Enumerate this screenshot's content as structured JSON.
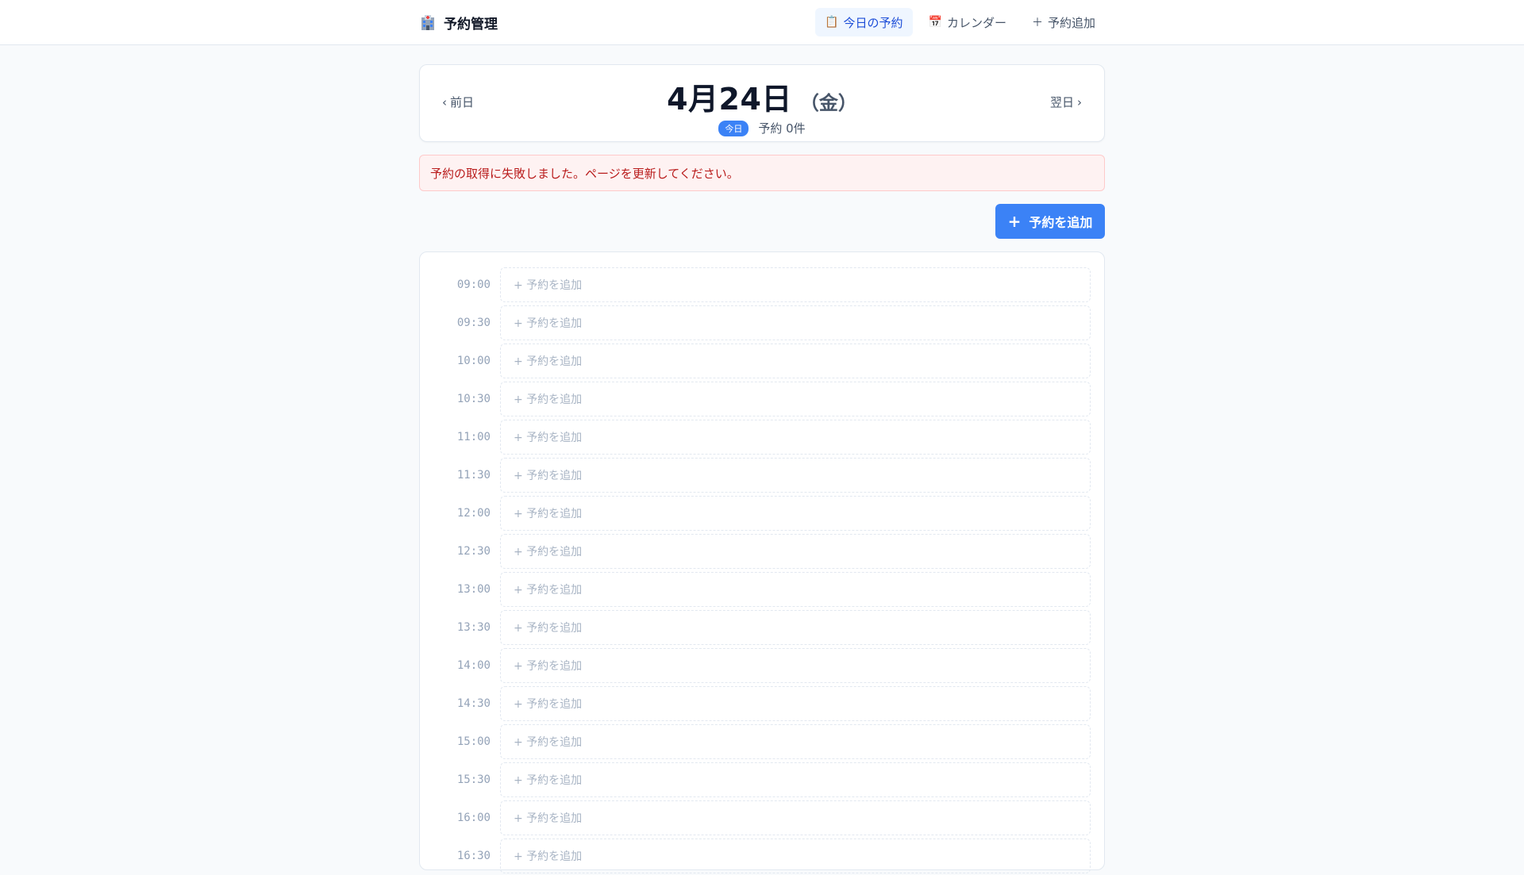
{
  "header": {
    "brand": "予約管理",
    "brand_icon": "hospital-icon",
    "nav": [
      {
        "icon": "📋",
        "icon_name": "clipboard-icon",
        "label": "今日の予約",
        "active": true
      },
      {
        "icon": "📅",
        "icon_name": "calendar-icon",
        "label": "カレンダー",
        "active": false
      },
      {
        "icon": "＋",
        "icon_name": "plus-icon",
        "label": "予約追加",
        "active": false
      }
    ]
  },
  "date_nav": {
    "prev_label": "前日",
    "next_label": "翌日",
    "date": "4月24日",
    "weekday": "（金）",
    "today_badge": "今日",
    "count": "予約 0件"
  },
  "error": {
    "message": "予約の取得に失敗しました。ページを更新してください。"
  },
  "add_button": {
    "label": "予約を追加"
  },
  "schedule": {
    "slots": [
      {
        "time": "09:00",
        "label": "+ 予約を追加"
      },
      {
        "time": "09:30",
        "label": "+ 予約を追加"
      },
      {
        "time": "10:00",
        "label": "+ 予約を追加"
      },
      {
        "time": "10:30",
        "label": "+ 予約を追加"
      },
      {
        "time": "11:00",
        "label": "+ 予約を追加"
      },
      {
        "time": "11:30",
        "label": "+ 予約を追加"
      },
      {
        "time": "12:00",
        "label": "+ 予約を追加"
      },
      {
        "time": "12:30",
        "label": "+ 予約を追加"
      },
      {
        "time": "13:00",
        "label": "+ 予約を追加"
      },
      {
        "time": "13:30",
        "label": "+ 予約を追加"
      },
      {
        "time": "14:00",
        "label": "+ 予約を追加"
      },
      {
        "time": "14:30",
        "label": "+ 予約を追加"
      },
      {
        "time": "15:00",
        "label": "+ 予約を追加"
      },
      {
        "time": "15:30",
        "label": "+ 予約を追加"
      },
      {
        "time": "16:00",
        "label": "+ 予約を追加"
      },
      {
        "time": "16:30",
        "label": "+ 予約を追加"
      }
    ]
  },
  "colors": {
    "accent": "#3b82f6",
    "error_bg": "#fef2f2",
    "error_text": "#b91c1c"
  }
}
